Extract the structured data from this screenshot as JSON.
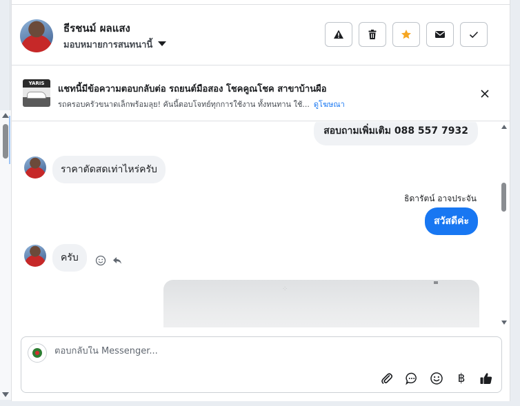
{
  "header": {
    "contact_name": "ธีรชนม์ ผลแสง",
    "assign_label": "มอบหมายการสนทนานี้",
    "actions": [
      {
        "name": "report",
        "icon": "warning-icon"
      },
      {
        "name": "delete",
        "icon": "trash-icon"
      },
      {
        "name": "star",
        "icon": "star-icon"
      },
      {
        "name": "mark-unread",
        "icon": "envelope-icon"
      },
      {
        "name": "mark-done",
        "icon": "check-icon"
      }
    ]
  },
  "ad": {
    "thumb_text": "YARIS",
    "title": "แชทนี้มีข้อความตอบกลับต่อ รถยนต์มือสอง โชคคูณโชค สาขาบ้านผือ",
    "description": "รถครอบครัวขนาดเล็กพร้อมลุย! คันนี้ตอบโจทย์ทุกการใช้งาน ทั้งทนทาน ใช้...",
    "link_label": "ดูโฆษณา"
  },
  "messages": {
    "out_top": "สอบถามเพิ่มเติม 088 557 7932",
    "in_price": "ราคาตัดสดเท่าไหร่ครับ",
    "sender_name": "ธิดารัตน์ อาจประจัน",
    "out_hello": "สวัสดีค่ะ",
    "in_ok": "ครับ"
  },
  "composer": {
    "placeholder": "ตอบกลับใน Messenger...",
    "baht_symbol": "฿"
  },
  "colors": {
    "accent": "#1877f2",
    "star": "#f5a623",
    "bubble_gray": "#f0f2f5"
  }
}
